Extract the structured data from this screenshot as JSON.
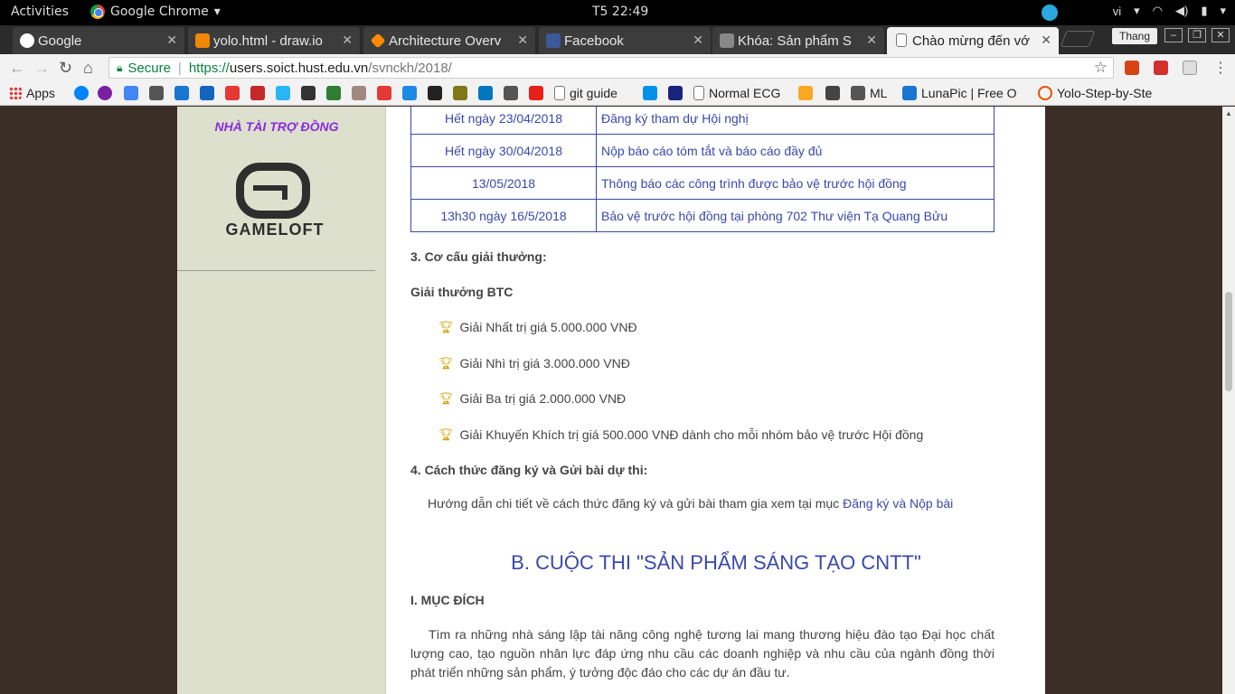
{
  "os": {
    "activities": "Activities",
    "app_name": "Google Chrome",
    "clock": "T5 22:49",
    "lang": "vi"
  },
  "tabs": [
    {
      "title": "Google"
    },
    {
      "title": "yolo.html - draw.io"
    },
    {
      "title": "Architecture Overv"
    },
    {
      "title": "Facebook"
    },
    {
      "title": "Khóa: Sản phẩm S"
    },
    {
      "title": "Chào mừng đến vớ"
    }
  ],
  "profile": "Thang",
  "address": {
    "secure": "Secure",
    "scheme": "https://",
    "host": "users.soict.hust.edu.vn",
    "path": "/svnckh/2018/"
  },
  "bookmarks": {
    "apps": "Apps",
    "git_guide": "git guide",
    "normal_ecg": "Normal ECG",
    "ml": "ML",
    "lunapic": "LunaPic | Free O",
    "yolo": "Yolo-Step-by-Ste"
  },
  "sidebar": {
    "sponsor_title": "NHÀ TÀI TRỢ ĐỒNG",
    "sponsor_name": "GAMELOFT"
  },
  "schedule": [
    {
      "date": "Hết ngày 23/04/2018",
      "event": "Đăng ký tham dự Hội nghị"
    },
    {
      "date": "Hết ngày 30/04/2018",
      "event": "Nộp báo cáo tóm tắt và báo cáo đầy đủ"
    },
    {
      "date": "13/05/2018",
      "event": "Thông báo các công trình được bảo vệ trước hội đồng"
    },
    {
      "date": "13h30 ngày 16/5/2018",
      "event": "Bảo vệ trước hội đồng tại phòng 702 Thư viện Tạ Quang Bửu"
    }
  ],
  "awards": {
    "heading": "3. Cơ cấu giải thưởng:",
    "subheading": "Giải thưởng BTC",
    "items": [
      "Giải Nhất trị giá 5.000.000 VNĐ",
      "Giải Nhì trị giá 3.000.000 VNĐ",
      "Giải Ba trị giá 2.000.000 VNĐ",
      "Giải Khuyến Khích trị giá 500.000 VNĐ dành cho mỗi nhóm bảo vệ trước Hội đồng"
    ]
  },
  "registration": {
    "heading": "4. Cách thức đăng ký và Gửi bài dự thi:",
    "text": "Hướng dẫn chi tiết về cách thức đăng ký và gửi bài tham gia xem tại mục ",
    "link": "Đăng ký và Nộp bài"
  },
  "section_b": {
    "title": "B. CUỘC THI \"SẢN PHẨM SÁNG TẠO CNTT\"",
    "purpose_heading": "I. MỤC ĐÍCH",
    "purpose_text": "Tìm ra những nhà sáng lập tài năng công nghệ tương lai mang thương hiệu đào tạo Đại học chất lượng cao, tạo nguồn nhân lực đáp ứng nhu cầu các doanh nghiệp và nhu cầu của ngành đồng thời phát triển những sản phẩm, ý tưởng độc đáo cho các dự án đầu tư."
  }
}
